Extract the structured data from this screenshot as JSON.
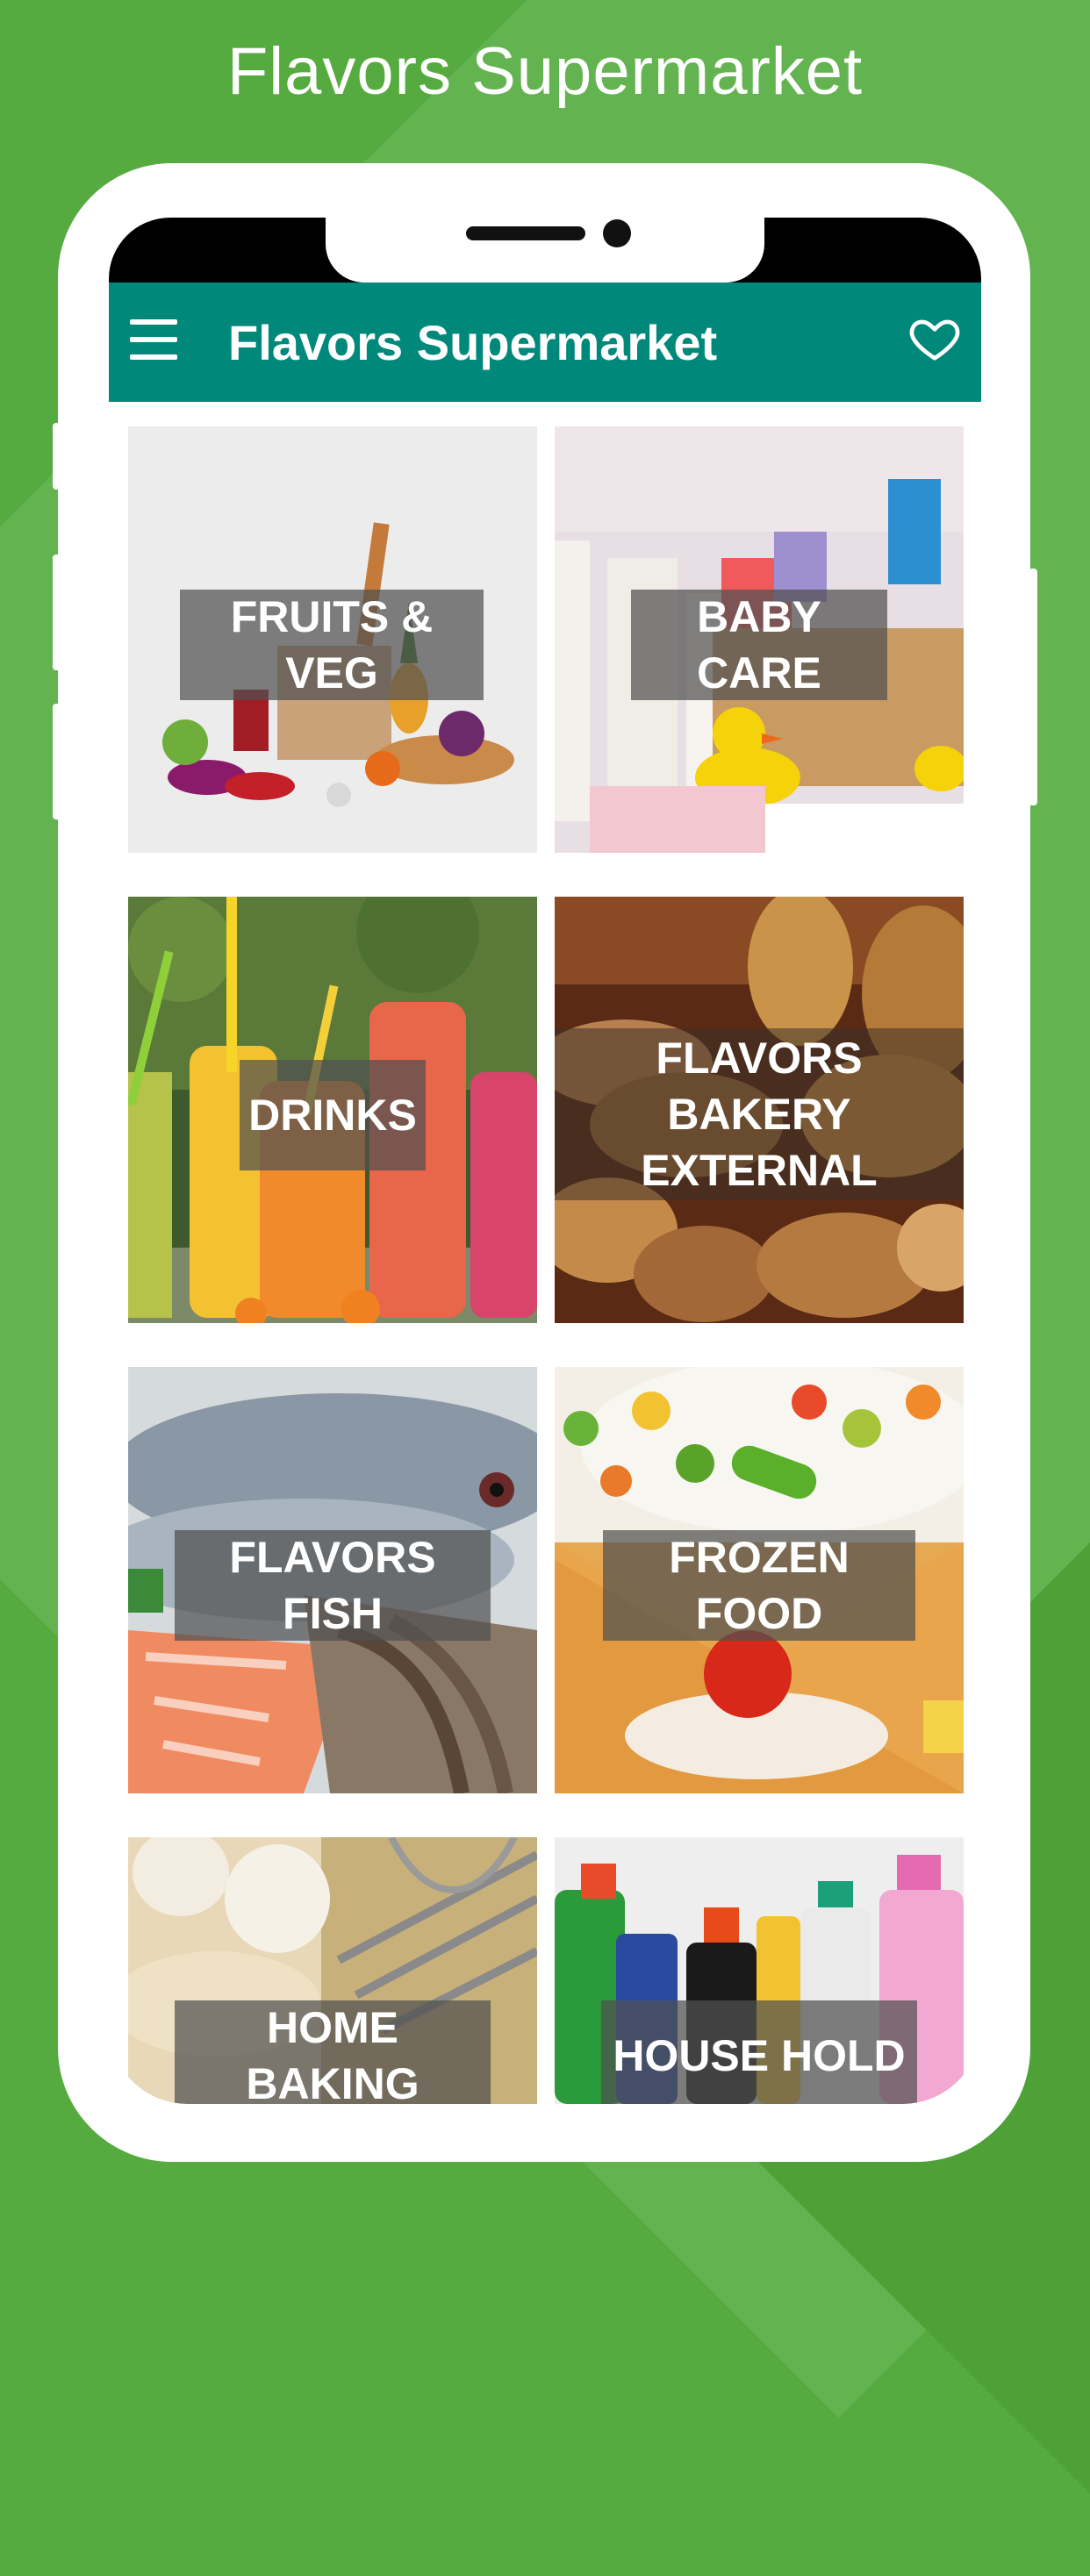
{
  "promo": {
    "title": "Flavors Supermarket"
  },
  "app": {
    "title": "Flavors Supermarket",
    "menu_icon": "hamburger-menu-icon",
    "favorite_icon": "heart-outline-icon",
    "accent": "#00897b"
  },
  "categories": [
    {
      "label": "FRUITS & VEG"
    },
    {
      "label": "BABY CARE"
    },
    {
      "label": "DRINKS"
    },
    {
      "label": "FLAVORS BAKERY EXTERNAL"
    },
    {
      "label": "FLAVORS FISH"
    },
    {
      "label": "FROZEN FOOD"
    },
    {
      "label": "HOME BAKING"
    },
    {
      "label": "HOUSE HOLD"
    }
  ]
}
